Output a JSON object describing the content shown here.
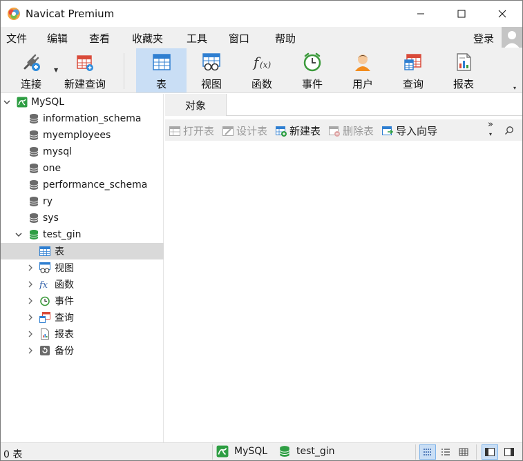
{
  "window": {
    "title": "Navicat Premium"
  },
  "menu": {
    "items": [
      "文件",
      "编辑",
      "查看",
      "收藏夹",
      "工具",
      "窗口",
      "帮助"
    ],
    "login": "登录"
  },
  "toolbar": {
    "connect": "连接",
    "new_query": "新建查询",
    "table": "表",
    "view": "视图",
    "function": "函数",
    "event": "事件",
    "user": "用户",
    "query": "查询",
    "report": "报表",
    "overflow": "»"
  },
  "tree": {
    "connection": "MySQL",
    "databases": [
      "information_schema",
      "myemployees",
      "mysql",
      "one",
      "performance_schema",
      "ry",
      "sys"
    ],
    "open_database": "test_gin",
    "children": [
      "表",
      "视图",
      "函数",
      "事件",
      "查询",
      "报表",
      "备份"
    ],
    "selected_child": "表"
  },
  "tabs": {
    "objects": "对象"
  },
  "object_toolbar": {
    "open_table": "打开表",
    "design_table": "设计表",
    "new_table": "新建表",
    "delete_table": "删除表",
    "import_wizard": "导入向导",
    "overflow": "»"
  },
  "status": {
    "count": "0 表",
    "connection": "MySQL",
    "database": "test_gin"
  },
  "colors": {
    "accent": "#c9def5",
    "mysql_green": "#2e9e43",
    "selected_row": "#d9d9d9"
  }
}
